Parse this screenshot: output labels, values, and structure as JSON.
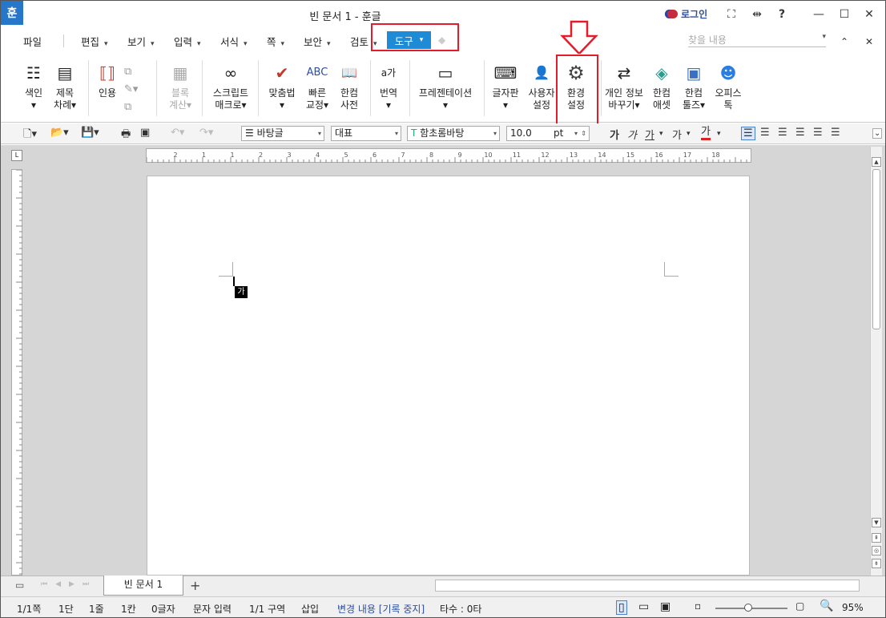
{
  "title_bar": {
    "app_icon": "훈",
    "title": "빈 문서 1 - 훈글",
    "login": "로그인",
    "buttons": {
      "fullscreen": "⛶",
      "split": "⇹",
      "help": "?",
      "minimize": "—",
      "maximize": "☐",
      "close": "✕"
    }
  },
  "menu": {
    "items": [
      {
        "label": "파일",
        "arrow": ""
      },
      {
        "label": "편집",
        "arrow": "▾"
      },
      {
        "label": "보기",
        "arrow": "▾"
      },
      {
        "label": "입력",
        "arrow": "▾"
      },
      {
        "label": "서식",
        "arrow": "▾"
      },
      {
        "label": "쪽",
        "arrow": "▾"
      },
      {
        "label": "보안",
        "arrow": "▾"
      },
      {
        "label": "검토",
        "arrow": "▾"
      }
    ],
    "active": {
      "label": "도구",
      "arrow": "▾"
    },
    "search_placeholder": "찾을 내용",
    "collapse": "⌃",
    "close": "✕"
  },
  "ribbon": {
    "items": [
      {
        "l1": "색인",
        "l2": "▾",
        "icon": "index-icon",
        "glyph": "☷"
      },
      {
        "l1": "제목",
        "l2": "차례▾",
        "icon": "toc-icon",
        "glyph": "▤"
      },
      {
        "l1": "인용",
        "l2": "",
        "icon": "citation-icon",
        "glyph": "⟦⟧"
      },
      {
        "l1": "블록",
        "l2": "계산▾",
        "icon": "block-calc-icon",
        "glyph": "▦"
      },
      {
        "l1": "스크립트",
        "l2": "매크로▾",
        "icon": "macro-icon",
        "glyph": "∞"
      },
      {
        "l1": "맞춤법",
        "l2": "▾",
        "icon": "spellcheck-icon",
        "glyph": "✔"
      },
      {
        "l1": "빠른",
        "l2": "교정▾",
        "icon": "quick-correct-icon",
        "glyph": "ABC"
      },
      {
        "l1": "한컴",
        "l2": "사전",
        "icon": "dictionary-icon",
        "glyph": "📖"
      },
      {
        "l1": "번역",
        "l2": "▾",
        "icon": "translate-icon",
        "glyph": "a가"
      },
      {
        "l1": "프레젠테이션",
        "l2": "▾",
        "icon": "presentation-icon",
        "glyph": "▭"
      },
      {
        "l1": "글자판",
        "l2": "▾",
        "icon": "keyboard-icon",
        "glyph": "⌨"
      },
      {
        "l1": "사용자",
        "l2": "설정",
        "icon": "user-settings-icon",
        "glyph": "👤"
      },
      {
        "l1": "환경",
        "l2": "설정",
        "icon": "gear-icon",
        "glyph": "⚙"
      },
      {
        "l1": "개인 정보",
        "l2": "바꾸기▾",
        "icon": "privacy-icon",
        "glyph": "⇄"
      },
      {
        "l1": "한컴",
        "l2": "애셋",
        "icon": "asset-icon",
        "glyph": "◈"
      },
      {
        "l1": "한컴",
        "l2": "툴즈▾",
        "icon": "tools-icon",
        "glyph": "▣"
      },
      {
        "l1": "오피스",
        "l2": "톡",
        "icon": "office-talk-icon",
        "glyph": "☻"
      }
    ]
  },
  "format_bar": {
    "style": "바탕글",
    "language": "대표",
    "font": "함초롬바탕",
    "size": "10.0",
    "unit": "pt",
    "bold": "가",
    "italic": "가",
    "underline": "가",
    "strike": "가",
    "color": "가"
  },
  "ruler": {
    "marks": [
      "2",
      "1",
      "1",
      "2",
      "3",
      "4",
      "5",
      "6",
      "7",
      "8",
      "9",
      "10",
      "11",
      "12",
      "13",
      "14",
      "15",
      "16",
      "17",
      "18"
    ]
  },
  "document": {
    "ime_indicator": "가"
  },
  "tabs": {
    "doc_tab": "빈 문서 1",
    "add": "+"
  },
  "status_bar": {
    "page": "1/1쪽",
    "column": "1단",
    "line": "1줄",
    "col_pos": "1칸",
    "chars": "0글자",
    "input_mode": "문자 입력",
    "section": "1/1 구역",
    "insert": "삽입",
    "track_changes": "변경 내용 [기록 중지]",
    "typing_speed": "타수 : 0타",
    "zoom": "95%"
  },
  "colors": {
    "accent": "#1f8ad6",
    "highlight": "#e41c2a",
    "track": "#2c4fa0"
  }
}
